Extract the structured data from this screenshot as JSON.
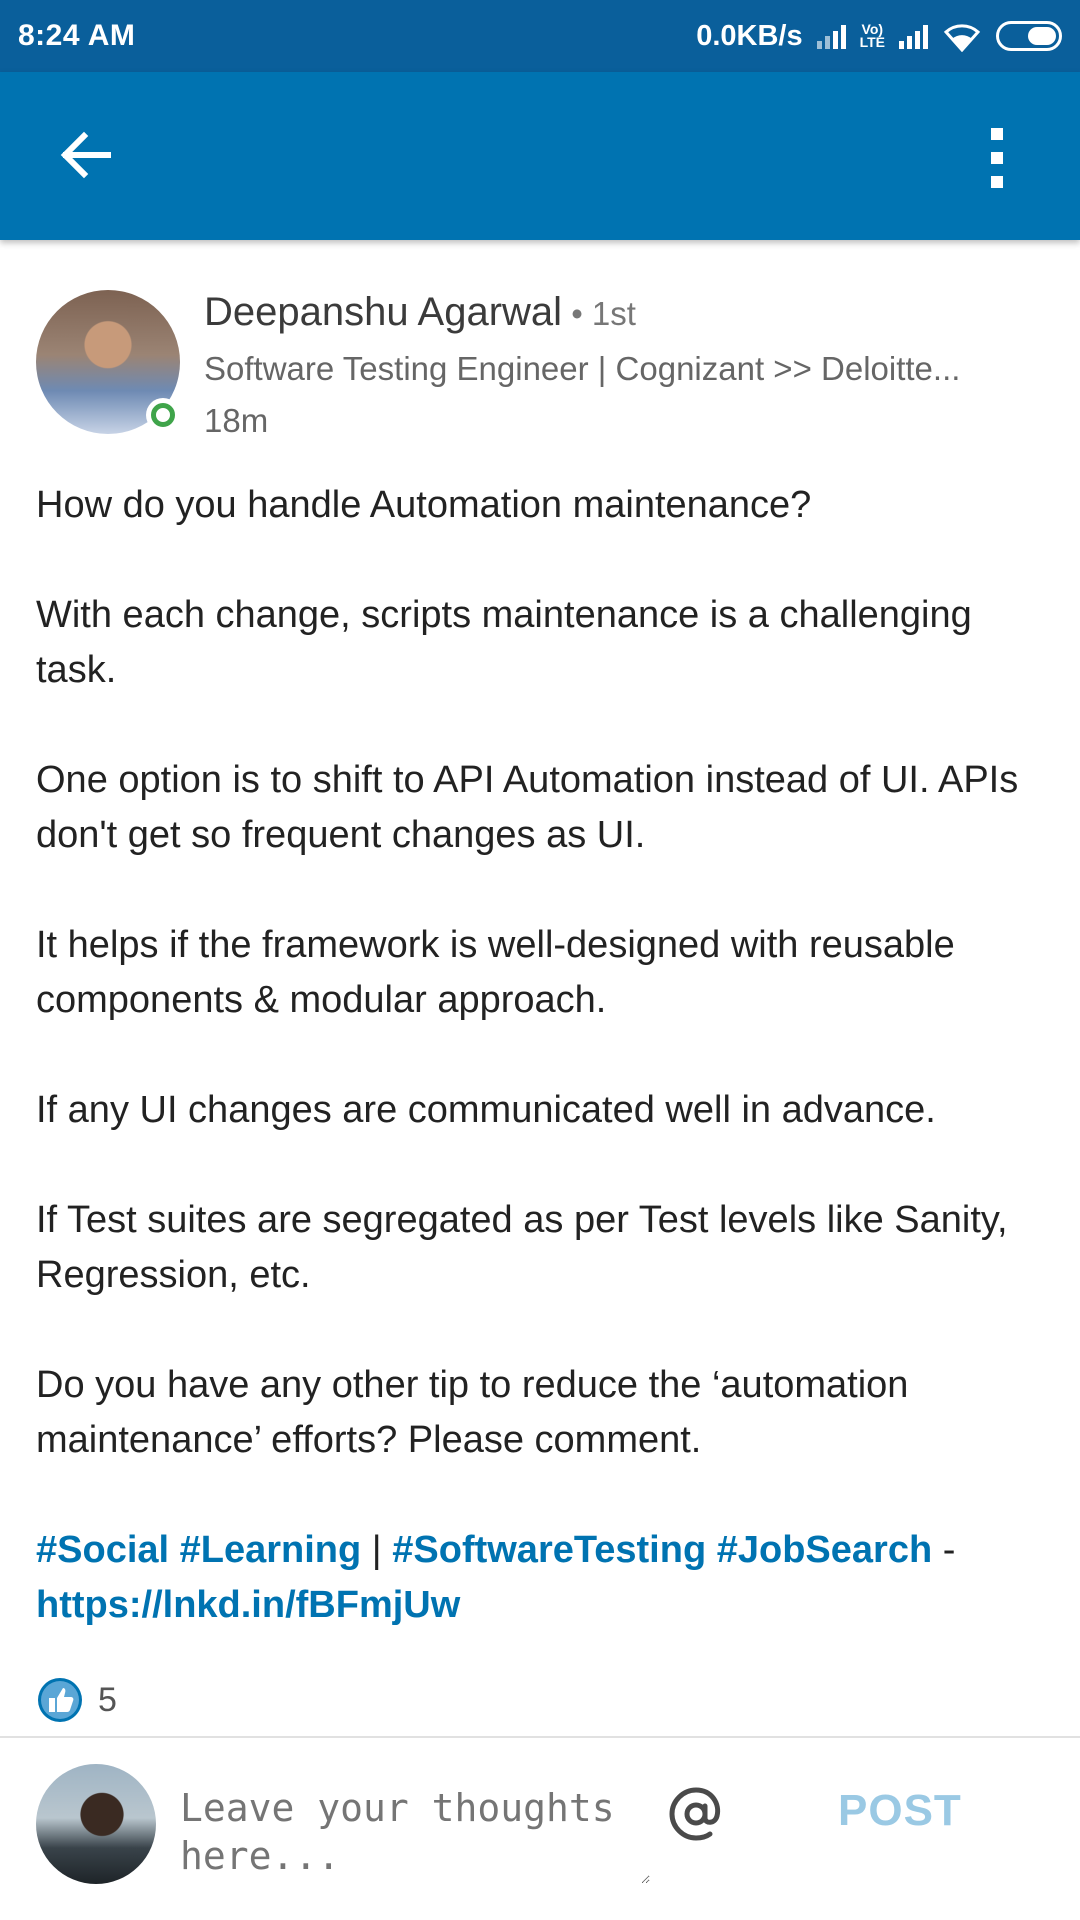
{
  "status_bar": {
    "time": "8:24 AM",
    "net_speed": "0.0KB/s",
    "lte_top": "Vo)",
    "lte_bottom": "LTE"
  },
  "app_bar": {
    "accent_color": "#0073b1",
    "back_icon": "arrow-left-icon",
    "menu_icon": "more-vertical-icon"
  },
  "post": {
    "author_name": "Deepanshu Agarwal",
    "degree": " • 1st",
    "headline": "Software Testing Engineer | Cognizant >> Deloitte...",
    "time_ago": "18m",
    "paragraphs": [
      "How do you handle Automation maintenance?",
      "With each change, scripts maintenance is a challenging task.",
      "One option is to shift to API Automation instead of UI. APIs don't get so frequent changes as UI.",
      "It helps if the framework is well-designed with reusable components & modular approach.",
      "If any UI changes are communicated well in advance.",
      "If Test suites are segregated as per Test levels like Sanity, Regression, etc.",
      "Do you have any other tip to reduce the ‘automation maintenance’ efforts? Please comment."
    ],
    "tags": {
      "tag1": "#Social",
      "tag2": "#Learning",
      "sep1": " | ",
      "tag3": "#SoftwareTesting",
      "tag4": "#JobSearch",
      "sep2": " -",
      "link": "https://lnkd.in/fBFmjUw"
    },
    "reactions": {
      "like_icon": "thumbs-up-icon",
      "count": "5"
    }
  },
  "composer": {
    "placeholder": "Leave your thoughts here...",
    "mention_icon": "at-sign-icon",
    "post_label": "POST"
  }
}
